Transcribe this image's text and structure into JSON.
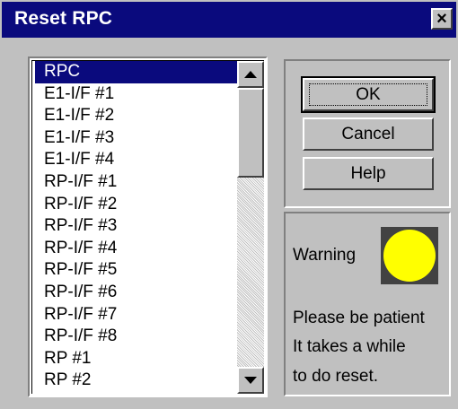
{
  "window": {
    "title": "Reset RPC",
    "close_glyph": "×"
  },
  "list": {
    "items": [
      "RPC",
      "E1-I/F #1",
      "E1-I/F #2",
      "E1-I/F #3",
      "E1-I/F #4",
      "RP-I/F #1",
      "RP-I/F #2",
      "RP-I/F #3",
      "RP-I/F #4",
      "RP-I/F #5",
      "RP-I/F #6",
      "RP-I/F #7",
      "RP-I/F #8",
      "RP #1",
      "RP #2"
    ],
    "selected": "RPC"
  },
  "buttons": {
    "ok": "OK",
    "cancel": "Cancel",
    "help": "Help"
  },
  "status": {
    "warning_label": "Warning",
    "indicator_color": "#ffff00",
    "message_lines": [
      "Please be patient",
      "It takes a while",
      "to do reset."
    ]
  },
  "icons": {
    "close": "close-icon",
    "scroll_up": "scroll-up-arrow-icon",
    "scroll_down": "scroll-down-arrow-icon",
    "indicator": "warning-indicator-icon"
  }
}
